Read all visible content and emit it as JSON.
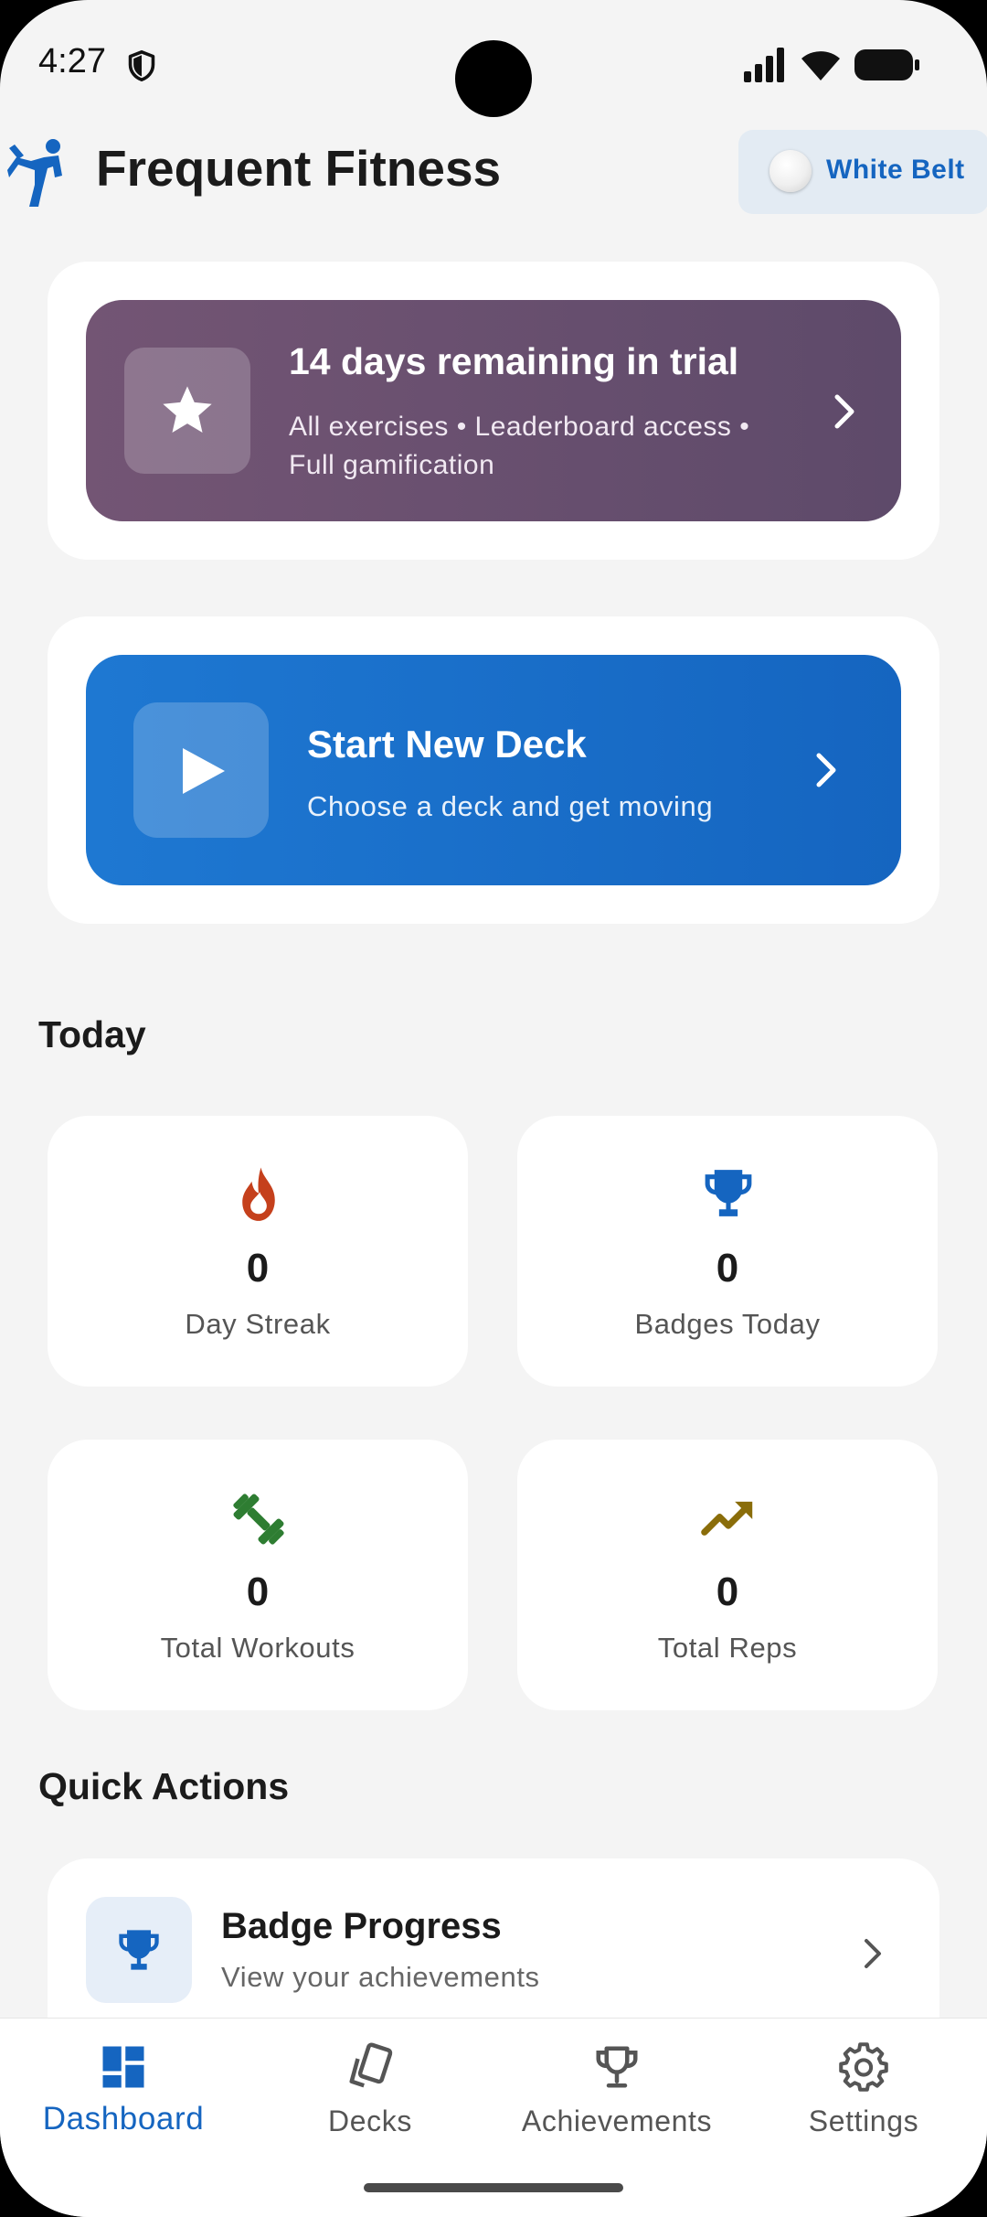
{
  "status_bar": {
    "time": "4:27"
  },
  "header": {
    "title": "Frequent Fitness",
    "belt_label": "White Belt"
  },
  "trial": {
    "title": "14 days remaining in trial",
    "subtitle": "All exercises • Leaderboard access • Full gamification"
  },
  "deck": {
    "title": "Start New Deck",
    "subtitle": "Choose a deck and get moving"
  },
  "today": {
    "title": "Today",
    "stats": [
      {
        "value": "0",
        "label": "Day Streak",
        "icon": "flame-icon",
        "color": "#c5401c"
      },
      {
        "value": "0",
        "label": "Badges Today",
        "icon": "trophy-icon",
        "color": "#1565c0"
      },
      {
        "value": "0",
        "label": "Total Workouts",
        "icon": "dumbbell-icon",
        "color": "#2e7d32"
      },
      {
        "value": "0",
        "label": "Total Reps",
        "icon": "trending-up-icon",
        "color": "#8a6d0a"
      }
    ]
  },
  "quick_actions": {
    "title": "Quick Actions",
    "items": [
      {
        "title": "Badge Progress",
        "subtitle": "View your achievements",
        "icon": "trophy-icon"
      }
    ]
  },
  "nav": {
    "items": [
      {
        "label": "Dashboard",
        "icon": "dashboard-icon",
        "active": true
      },
      {
        "label": "Decks",
        "icon": "cards-icon",
        "active": false
      },
      {
        "label": "Achievements",
        "icon": "trophy-outline-icon",
        "active": false
      },
      {
        "label": "Settings",
        "icon": "gear-icon",
        "active": false
      }
    ]
  },
  "colors": {
    "primary": "#1565c0",
    "trial_banner": "#6a4f6e",
    "background": "#f4f4f4"
  }
}
